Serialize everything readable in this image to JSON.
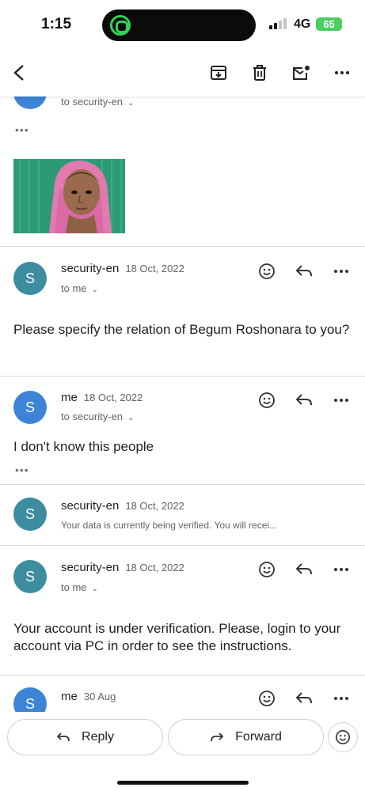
{
  "status_bar": {
    "time": "1:15",
    "network": "4G",
    "battery": "65"
  },
  "messages": [
    {
      "recipient": "to security-en"
    },
    {
      "sender": "security-en",
      "date": "18 Oct, 2022",
      "recipient": "to me",
      "body": "Please specify the relation of Begum Roshonara to you?",
      "avatar_letter": "S"
    },
    {
      "sender": "me",
      "date": "18 Oct, 2022",
      "recipient": "to security-en",
      "body": "I don't know this people",
      "avatar_letter": "S"
    },
    {
      "sender": "security-en",
      "date": "18 Oct, 2022",
      "snippet": "Your data is currently being verified. You will recei...",
      "avatar_letter": "S"
    },
    {
      "sender": "security-en",
      "date": "18 Oct, 2022",
      "recipient": "to me",
      "body": "Your account is under verification. Please, login to your account via PC in order to see the instructions.",
      "avatar_letter": "S"
    },
    {
      "sender": "me",
      "date": "30 Aug",
      "avatar_letter": "S"
    }
  ],
  "bottom_bar": {
    "reply_label": "Reply",
    "forward_label": "Forward"
  },
  "colors": {
    "teal_avatar": "#3d8ca0",
    "blue_avatar": "#3d84d6",
    "battery": "#4ccd5f"
  }
}
